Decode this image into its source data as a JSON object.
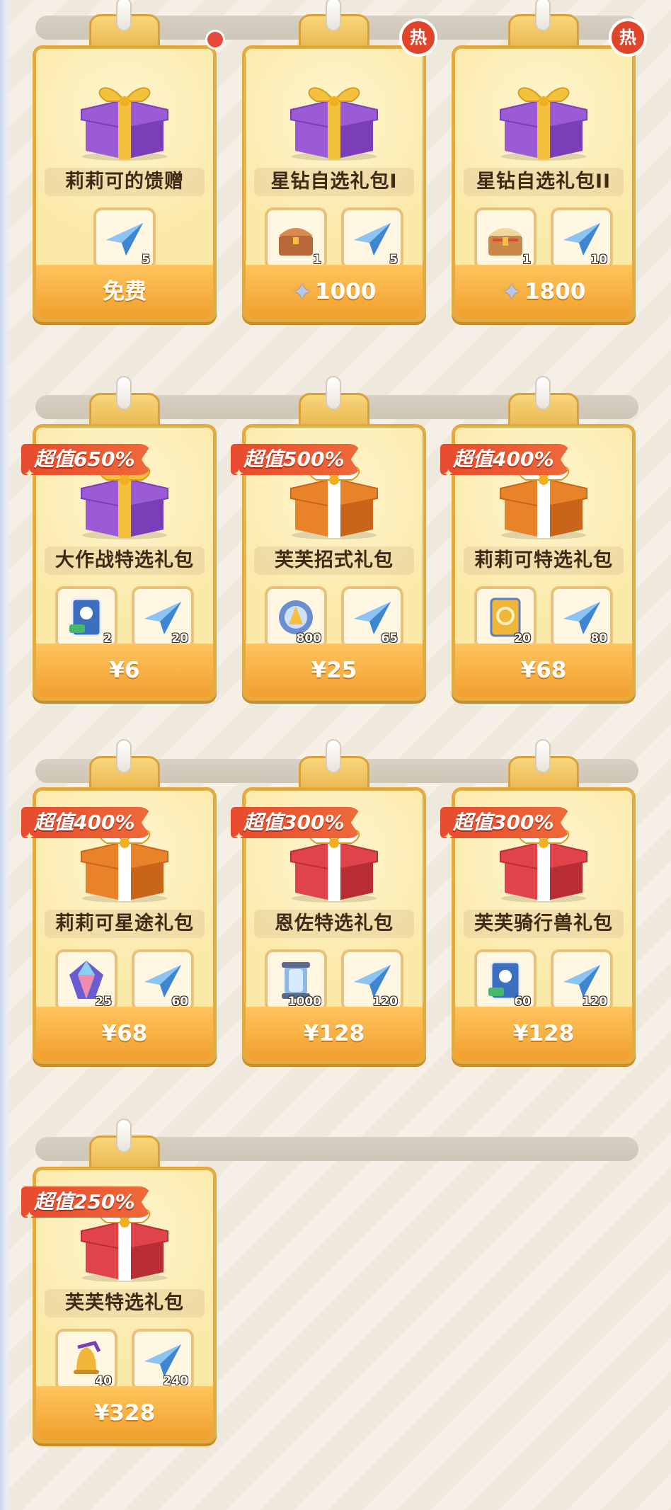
{
  "rows": [
    [
      {
        "name": "莉莉可的馈赠",
        "price": "免费",
        "price_icon": "",
        "badge": "",
        "hot": false,
        "dot": true,
        "gift": "purple",
        "items": [
          {
            "icon": "paper-plane-icon",
            "qty": "5"
          }
        ]
      },
      {
        "name": "星钻自选礼包I",
        "price": "1000",
        "price_icon": "star-diamond-icon",
        "badge": "",
        "hot": true,
        "dot": false,
        "gift": "purple",
        "items": [
          {
            "icon": "treasure-chest-icon",
            "qty": "1"
          },
          {
            "icon": "paper-plane-icon",
            "qty": "5"
          }
        ]
      },
      {
        "name": "星钻自选礼包II",
        "price": "1800",
        "price_icon": "star-diamond-icon",
        "badge": "",
        "hot": true,
        "dot": false,
        "gift": "purple",
        "items": [
          {
            "icon": "golden-chest-icon",
            "qty": "1"
          },
          {
            "icon": "paper-plane-icon",
            "qty": "10"
          }
        ]
      }
    ],
    [
      {
        "name": "大作战特选礼包",
        "price": "¥6",
        "price_icon": "",
        "badge": "超值650%",
        "hot": false,
        "dot": false,
        "gift": "purple",
        "items": [
          {
            "icon": "character-card-icon",
            "qty": "2"
          },
          {
            "icon": "paper-plane-icon",
            "qty": "20"
          }
        ]
      },
      {
        "name": "芙芙招式礼包",
        "price": "¥25",
        "price_icon": "",
        "badge": "超值500%",
        "hot": false,
        "dot": false,
        "gift": "orange",
        "items": [
          {
            "icon": "skill-orb-icon",
            "qty": "800"
          },
          {
            "icon": "paper-plane-icon",
            "qty": "65"
          }
        ]
      },
      {
        "name": "莉莉可特选礼包",
        "price": "¥68",
        "price_icon": "",
        "badge": "超值400%",
        "hot": false,
        "dot": false,
        "gift": "orange",
        "items": [
          {
            "icon": "gold-card-icon",
            "qty": "20"
          },
          {
            "icon": "paper-plane-icon",
            "qty": "80"
          }
        ]
      }
    ],
    [
      {
        "name": "莉莉可星途礼包",
        "price": "¥68",
        "price_icon": "",
        "badge": "超值400%",
        "hot": false,
        "dot": false,
        "gift": "orange",
        "items": [
          {
            "icon": "rainbow-crystal-icon",
            "qty": "25"
          },
          {
            "icon": "paper-plane-icon",
            "qty": "60"
          }
        ]
      },
      {
        "name": "恩佐特选礼包",
        "price": "¥128",
        "price_icon": "",
        "badge": "超值300%",
        "hot": false,
        "dot": false,
        "gift": "red",
        "items": [
          {
            "icon": "energy-canister-icon",
            "qty": "1000"
          },
          {
            "icon": "paper-plane-icon",
            "qty": "120"
          }
        ]
      },
      {
        "name": "芙芙骑行兽礼包",
        "price": "¥128",
        "price_icon": "",
        "badge": "超值300%",
        "hot": false,
        "dot": false,
        "gift": "red",
        "items": [
          {
            "icon": "character-card-icon",
            "qty": "60"
          },
          {
            "icon": "paper-plane-icon",
            "qty": "120"
          }
        ]
      }
    ],
    [
      {
        "name": "芙芙特选礼包",
        "price": "¥328",
        "price_icon": "",
        "badge": "超值250%",
        "hot": false,
        "dot": false,
        "gift": "red",
        "items": [
          {
            "icon": "magic-bell-icon",
            "qty": "40"
          },
          {
            "icon": "paper-plane-icon",
            "qty": "240"
          }
        ]
      }
    ]
  ],
  "hot_label": "热"
}
